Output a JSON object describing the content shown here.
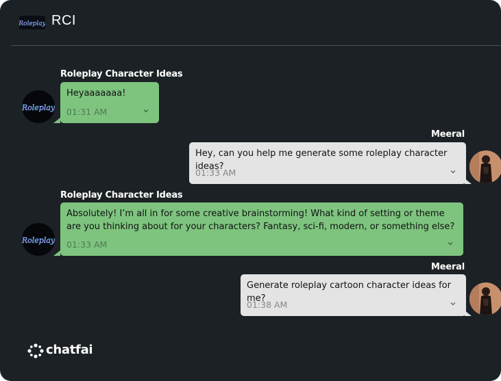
{
  "header": {
    "title": "RCI",
    "logo_icon": "roleplay-logo-icon"
  },
  "messages": [
    {
      "role": "bot",
      "sender": "Roleplay Character Ideas",
      "text": "Heyaaaaaaa!",
      "time": "01:31 AM"
    },
    {
      "role": "user",
      "sender": "Meeral",
      "text": "Hey, can you help me generate some roleplay character ideas?",
      "time": "01:33 AM"
    },
    {
      "role": "bot",
      "sender": "Roleplay Character Ideas",
      "text": "Absolutely! I’m all in for some creative brainstorming! What kind of setting or theme are you thinking about for your characters? Fantasy, sci-fi, modern, or something else?",
      "time": "01:33 AM"
    },
    {
      "role": "user",
      "sender": "Meeral",
      "text": "Generate roleplay cartoon character ideas for me?",
      "time": "01:38 AM"
    }
  ],
  "brand": {
    "name": "chatfai",
    "icon": "chatfai-logo-icon"
  },
  "colors": {
    "background": "#1b2124",
    "bot_bubble": "#7ec47f",
    "user_bubble": "#e4e4e4",
    "divider": "#4a5153"
  }
}
